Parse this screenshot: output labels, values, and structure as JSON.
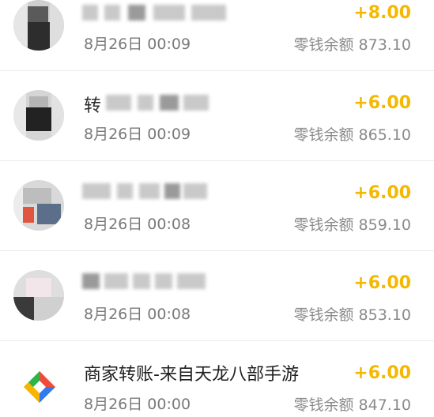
{
  "transactions": [
    {
      "title": "",
      "title_prefix": "",
      "date": "8月26日 00:09",
      "amount": "+8.00",
      "balance_label": "零钱余额",
      "balance": "873.10",
      "avatar": "blurred-user-avatar"
    },
    {
      "title": "",
      "title_prefix": "转",
      "date": "8月26日 00:09",
      "amount": "+6.00",
      "balance_label": "零钱余额",
      "balance": "865.10",
      "avatar": "blurred-user-avatar"
    },
    {
      "title": "",
      "title_prefix": "",
      "date": "8月26日 00:08",
      "amount": "+6.00",
      "balance_label": "零钱余额",
      "balance": "859.10",
      "avatar": "blurred-user-avatar"
    },
    {
      "title": "",
      "title_prefix": "",
      "date": "8月26日 00:08",
      "amount": "+6.00",
      "balance_label": "零钱余额",
      "balance": "853.10",
      "avatar": "blurred-user-avatar"
    },
    {
      "title": "商家转账-来自天龙八部手游",
      "title_prefix": "",
      "date": "8月26日 00:00",
      "amount": "+6.00",
      "balance_label": "零钱余额",
      "balance": "847.10",
      "avatar": "merchant-transfer-logo"
    }
  ],
  "colors": {
    "amount": "#f5b800",
    "title": "#1f1f1f",
    "secondary": "#7a7a7a",
    "divider": "#ececec",
    "logo_green": "#2bb54a",
    "logo_red": "#f04a3a",
    "logo_blue": "#2f7cf0",
    "logo_yellow": "#f7b500"
  }
}
